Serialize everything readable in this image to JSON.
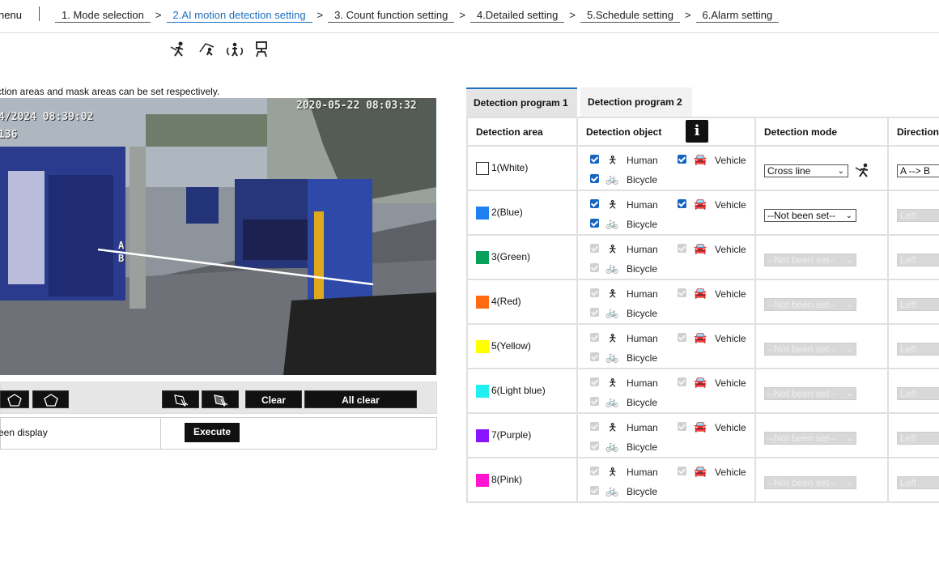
{
  "nav": {
    "menu": "nenu",
    "steps": [
      "1. Mode selection",
      "2.AI motion detection setting",
      "3. Count function setting",
      "4.Detailed setting",
      "5.Schedule setting",
      "6.Alarm setting"
    ]
  },
  "note": "ction areas and mask areas can be set respectively.",
  "camera": {
    "timestamp_right": "2020-05-22  08:03:32",
    "timestamp_left": "4/2024 08:39:02",
    "timestamp_left2": "136",
    "line_labels": [
      "A",
      "B"
    ]
  },
  "toolbar": {
    "clear": "Clear",
    "all_clear": "All clear"
  },
  "bottom": {
    "label": "een display",
    "execute": "Execute"
  },
  "tabs": [
    "Detection program 1",
    "Detection program 2"
  ],
  "table": {
    "headers": [
      "Detection area",
      "Detection object",
      "Detection mode",
      "Direction"
    ],
    "object_labels": {
      "human": "Human",
      "vehicle": "Vehicle",
      "bicycle": "Bicycle"
    },
    "rows": [
      {
        "area": "1(White)",
        "color": "#ffffff",
        "mode": "Cross line",
        "direction": "A --> B",
        "enabled": true
      },
      {
        "area": "2(Blue)",
        "color": "#1e7ff0",
        "mode": "--Not been set--",
        "direction": "Left",
        "enabled": true
      },
      {
        "area": "3(Green)",
        "color": "#0aa05a",
        "mode": "--Not been set--",
        "direction": "Left",
        "enabled": false
      },
      {
        "area": "4(Red)",
        "color": "#ff6a13",
        "mode": "--Not been set--",
        "direction": "Left",
        "enabled": false
      },
      {
        "area": "5(Yellow)",
        "color": "#ffff00",
        "mode": "--Not been set--",
        "direction": "Left",
        "enabled": false
      },
      {
        "area": "6(Light blue)",
        "color": "#22f0f0",
        "mode": "--Not been set--",
        "direction": "Left",
        "enabled": false
      },
      {
        "area": "7(Purple)",
        "color": "#8a14ff",
        "mode": "--Not been set--",
        "direction": "Left",
        "enabled": false
      },
      {
        "area": "8(Pink)",
        "color": "#ff14d0",
        "mode": "--Not been set--",
        "direction": "Left",
        "enabled": false
      }
    ]
  },
  "icons": {
    "mode_icons": [
      "cross-line-icon",
      "intrusion-icon",
      "loitering-icon",
      "object-icon"
    ],
    "human": "human-icon",
    "vehicle": "vehicle-icon",
    "bicycle": "bicycle-icon",
    "info": "info-icon"
  }
}
